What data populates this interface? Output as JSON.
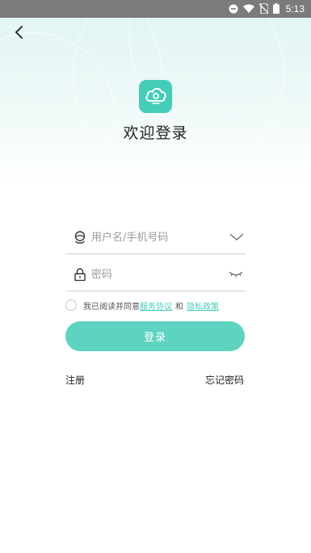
{
  "status_bar": {
    "time": "5:13",
    "icons": [
      "do-not-disturb-icon",
      "wifi-icon",
      "no-sim-icon",
      "battery-icon"
    ]
  },
  "nav": {
    "back_icon": "chevron-left-icon"
  },
  "header": {
    "title": "欢迎登录",
    "logo_icon": "cloud-icon"
  },
  "form": {
    "username": {
      "placeholder": "用户名/手机号码",
      "value": "",
      "icon": "user-icon",
      "trailing_icon": "chevron-down-icon"
    },
    "password": {
      "placeholder": "密码",
      "value": "",
      "icon": "lock-icon",
      "trailing_icon": "eye-closed-icon"
    }
  },
  "agreement": {
    "prefix": "我已阅读并同意",
    "terms_label": "服务协议",
    "conjunction": "和",
    "privacy_label": "隐私政策",
    "checked": false
  },
  "login_button": "登录",
  "links": {
    "register": "注册",
    "forgot_password": "忘记密码"
  },
  "colors": {
    "accent": "#45cdb8",
    "button": "#5dd3c0",
    "status_bar": "#7b7b7b"
  }
}
